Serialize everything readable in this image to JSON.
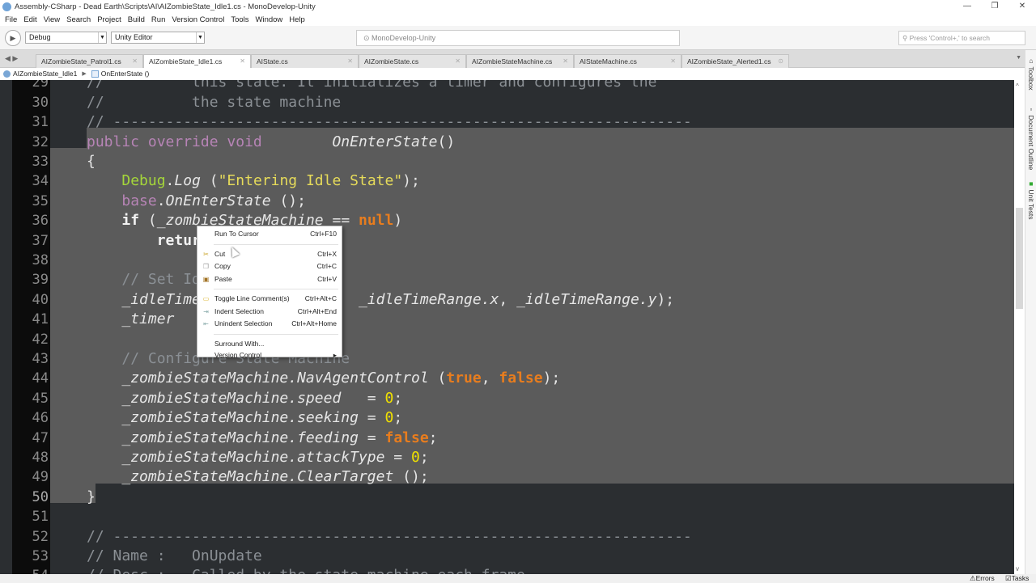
{
  "window": {
    "title": "Assembly-CSharp - Dead Earth\\Scripts\\AI\\AIZombieState_Idle1.cs - MonoDevelop-Unity",
    "minimize": "—",
    "restore": "❐",
    "close": "✕"
  },
  "menu": [
    "File",
    "Edit",
    "View",
    "Search",
    "Project",
    "Build",
    "Run",
    "Version Control",
    "Tools",
    "Window",
    "Help"
  ],
  "toolbar": {
    "config": "Debug",
    "target": "Unity Editor",
    "status": "MonoDevelop-Unity",
    "search_placeholder": "Press 'Control+,' to search"
  },
  "tabs": [
    {
      "label": "AIZombieState_Patrol1.cs",
      "active": false
    },
    {
      "label": "AIZombieState_Idle1.cs",
      "active": true
    },
    {
      "label": "AIState.cs",
      "active": false
    },
    {
      "label": "AIZombieState.cs",
      "active": false
    },
    {
      "label": "AIZombieStateMachine.cs",
      "active": false
    },
    {
      "label": "AIStateMachine.cs",
      "active": false
    },
    {
      "label": "AIZombieState_Alerted1.cs",
      "active": false
    }
  ],
  "breadcrumb": {
    "class": "AIZombieState_Idle1",
    "method": "OnEnterState ()"
  },
  "sidebar": {
    "toolbox": "Toolbox",
    "outline": "Document Outline",
    "unit_tests": "Unit Tests"
  },
  "statusbar": {
    "errors": "Errors",
    "tasks": "Tasks"
  },
  "colors": {
    "editor_bg": "#2b2e31",
    "selection": "#5b5b5b",
    "keyword": "#b784b6",
    "string": "#e6db5a",
    "literal": "#e87d1e",
    "type": "#a5d63a",
    "comment": "#8b9095"
  },
  "code": [
    {
      "n": "29",
      "t": [
        [
          "c",
          "//          this state. It initializes a timer and configures the"
        ]
      ]
    },
    {
      "n": "30",
      "t": [
        [
          "c",
          "//          the state machine"
        ]
      ]
    },
    {
      "n": "31",
      "t": [
        [
          "c",
          "// ------------------------------------------------------------------"
        ]
      ]
    },
    {
      "n": "32",
      "t": [
        [
          "k",
          "public override void"
        ],
        [
          "p",
          "        "
        ],
        [
          "m",
          "OnEnterState"
        ],
        [
          "p",
          "()"
        ]
      ]
    },
    {
      "n": "33",
      "t": [
        [
          "p",
          "{"
        ]
      ]
    },
    {
      "n": "34",
      "t": [
        [
          "p",
          "    "
        ],
        [
          "ty",
          "Debug"
        ],
        [
          "p",
          "."
        ],
        [
          "m",
          "Log"
        ],
        [
          "p",
          " ("
        ],
        [
          "s",
          "\"Entering Idle State\""
        ],
        [
          "p",
          ");"
        ]
      ]
    },
    {
      "n": "35",
      "t": [
        [
          "p",
          "    "
        ],
        [
          "k",
          "base"
        ],
        [
          "p",
          "."
        ],
        [
          "m",
          "OnEnterState"
        ],
        [
          "p",
          " ();"
        ]
      ]
    },
    {
      "n": "36",
      "t": [
        [
          "p",
          "    "
        ],
        [
          "kw",
          "if"
        ],
        [
          "p",
          " ("
        ],
        [
          "m",
          "_zombieStateMachine"
        ],
        [
          "p",
          " == "
        ],
        [
          "lit",
          "null"
        ],
        [
          "p",
          ")"
        ]
      ]
    },
    {
      "n": "37",
      "t": [
        [
          "p",
          "        "
        ],
        [
          "kw",
          "retur"
        ]
      ]
    },
    {
      "n": "38",
      "t": []
    },
    {
      "n": "39",
      "t": [
        [
          "p",
          "    "
        ],
        [
          "c",
          "// Set Id"
        ]
      ]
    },
    {
      "n": "40",
      "t": [
        [
          "p",
          "    "
        ],
        [
          "m",
          "_idleTime"
        ],
        [
          "p",
          "                  "
        ],
        [
          "m",
          "_idleTimeRange.x"
        ],
        [
          "p",
          ", "
        ],
        [
          "m",
          "_idleTimeRange.y"
        ],
        [
          "p",
          ");"
        ]
      ]
    },
    {
      "n": "41",
      "t": [
        [
          "p",
          "    "
        ],
        [
          "m",
          "_timer"
        ]
      ]
    },
    {
      "n": "42",
      "t": []
    },
    {
      "n": "43",
      "t": [
        [
          "p",
          "    "
        ],
        [
          "c",
          "// Configure State Machine"
        ]
      ]
    },
    {
      "n": "44",
      "t": [
        [
          "p",
          "    "
        ],
        [
          "m",
          "_zombieStateMachine.NavAgentControl"
        ],
        [
          "p",
          " ("
        ],
        [
          "lit",
          "true"
        ],
        [
          "p",
          ", "
        ],
        [
          "lit",
          "false"
        ],
        [
          "p",
          ");"
        ]
      ]
    },
    {
      "n": "45",
      "t": [
        [
          "p",
          "    "
        ],
        [
          "m",
          "_zombieStateMachine.speed"
        ],
        [
          "p",
          "   = "
        ],
        [
          "num0",
          "0"
        ],
        [
          "p",
          ";"
        ]
      ]
    },
    {
      "n": "46",
      "t": [
        [
          "p",
          "    "
        ],
        [
          "m",
          "_zombieStateMachine.seeking"
        ],
        [
          "p",
          " = "
        ],
        [
          "num0",
          "0"
        ],
        [
          "p",
          ";"
        ]
      ]
    },
    {
      "n": "47",
      "t": [
        [
          "p",
          "    "
        ],
        [
          "m",
          "_zombieStateMachine.feeding"
        ],
        [
          "p",
          " = "
        ],
        [
          "lit",
          "false"
        ],
        [
          "p",
          ";"
        ]
      ]
    },
    {
      "n": "48",
      "t": [
        [
          "p",
          "    "
        ],
        [
          "m",
          "_zombieStateMachine.attackType"
        ],
        [
          "p",
          " = "
        ],
        [
          "num0",
          "0"
        ],
        [
          "p",
          ";"
        ]
      ]
    },
    {
      "n": "49",
      "t": [
        [
          "p",
          "    "
        ],
        [
          "m",
          "_zombieStateMachine.ClearTarget"
        ],
        [
          "p",
          " ();"
        ]
      ]
    },
    {
      "n": "50",
      "t": [
        [
          "p",
          "}"
        ]
      ]
    },
    {
      "n": "51",
      "t": []
    },
    {
      "n": "52",
      "t": [
        [
          "c",
          "// ------------------------------------------------------------------"
        ]
      ]
    },
    {
      "n": "53",
      "t": [
        [
          "c",
          "// Name :   OnUpdate"
        ]
      ]
    },
    {
      "n": "54",
      "t": [
        [
          "c",
          "// Desc :   Called by the state machine each frame"
        ]
      ]
    }
  ],
  "context_menu": [
    {
      "label": "Run To Cursor",
      "shortcut": "Ctrl+F10",
      "icon": ""
    },
    {
      "sep": true
    },
    {
      "label": "Cut",
      "shortcut": "Ctrl+X",
      "icon": "scissors-icon"
    },
    {
      "label": "Copy",
      "shortcut": "Ctrl+C",
      "icon": "copy-icon"
    },
    {
      "label": "Paste",
      "shortcut": "Ctrl+V",
      "icon": "paste-icon"
    },
    {
      "sep": true
    },
    {
      "label": "Toggle Line Comment(s)",
      "shortcut": "Ctrl+Alt+C",
      "icon": "comment-icon"
    },
    {
      "label": "Indent Selection",
      "shortcut": "Ctrl+Alt+End",
      "icon": "indent-icon"
    },
    {
      "label": "Unindent Selection",
      "shortcut": "Ctrl+Alt+Home",
      "icon": "unindent-icon"
    },
    {
      "sep": true
    },
    {
      "label": "Surround With...",
      "shortcut": "",
      "icon": ""
    },
    {
      "label": "Version Control",
      "shortcut": "▸",
      "icon": ""
    }
  ]
}
